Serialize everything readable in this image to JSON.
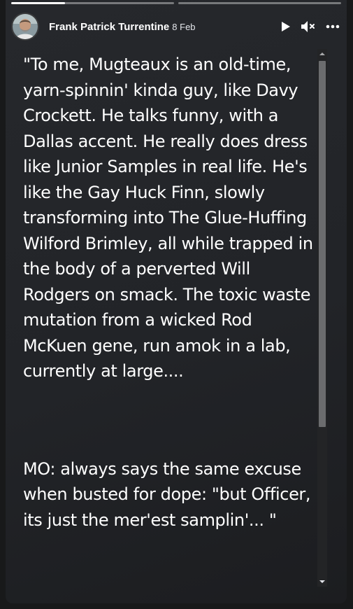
{
  "progress": {
    "segments": [
      {
        "fill": 0.33
      },
      {
        "fill": 0
      }
    ]
  },
  "header": {
    "author": "Frank Patrick Turrentine",
    "date": "8 Feb"
  },
  "controls": {
    "play_icon": "play-icon",
    "mute_icon": "mute-icon",
    "more_icon": "more-icon"
  },
  "post": {
    "paragraph1": "\"To me, Mugteaux is an old-time, yarn-spinnin' kinda guy, like Davy Crockett. He talks funny, with a Dallas accent. He really does dress like Junior Samples in real life. He's like the Gay Huck Finn, slowly transforming into The Glue-Huffing Wilford Brimley, all while trapped in the body of a perverted Will Rodgers on smack. The toxic waste mutation from a wicked Rod McKuen gene, run amok in a lab, currently at large....",
    "paragraph2": "MO: always says the same excuse when busted for dope: \"but Officer, its just the mer'est samplin'... \""
  },
  "colors": {
    "background": "#18191a",
    "card": "#242529",
    "text": "#ffffff"
  }
}
